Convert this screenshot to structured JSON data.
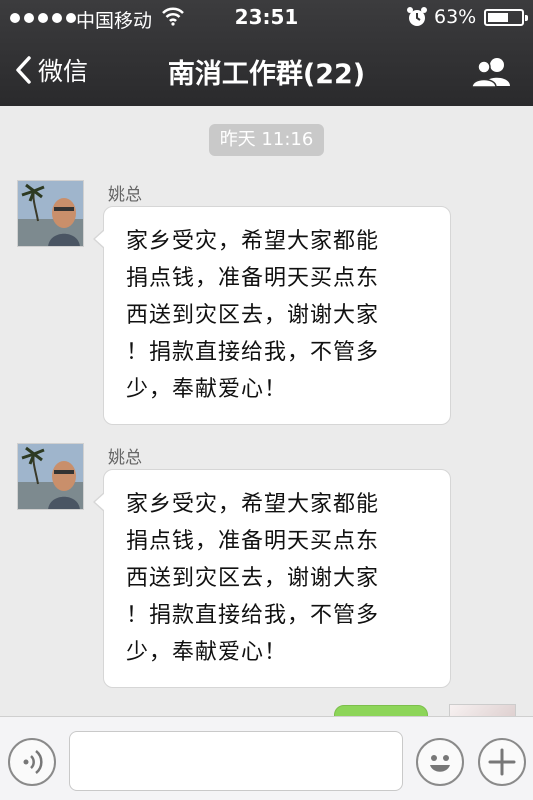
{
  "status_bar": {
    "carrier": "中国移动",
    "time": "23:51",
    "battery_text": "63%",
    "battery_level": 0.63,
    "signal_icon": "signal-dots-icon",
    "wifi_icon": "wifi-icon",
    "alarm_icon": "alarm-clock-icon"
  },
  "nav": {
    "back_label": "微信",
    "title": "南消工作群(22)",
    "back_icon": "chevron-left-icon",
    "members_icon": "group-members-icon"
  },
  "chat": {
    "timestamp": "昨天 11:16",
    "messages": [
      {
        "sender": "姚总",
        "lines": [
          "家乡受灾，希望大家都能",
          "捐点钱，准备明天买点东",
          "西送到灾区去，谢谢大家",
          "！捐款直接给我，不管多",
          "少，奉献爱心！"
        ]
      },
      {
        "sender": "姚总",
        "lines": [
          "家乡受灾，希望大家都能",
          "捐点钱，准备明天买点东",
          "西送到灾区去，谢谢大家",
          "！捐款直接给我，不管多",
          "少，奉献爱心！"
        ]
      }
    ]
  },
  "input_bar": {
    "placeholder": "",
    "voice_icon": "voice-icon",
    "emoji_icon": "emoji-icon",
    "more_icon": "plus-icon"
  },
  "colors": {
    "header_bg": "#2f2f31",
    "chat_bg": "#ebebeb",
    "outgoing_bubble": "#8dd559",
    "timestamp_bg": "#c9c9c9"
  }
}
